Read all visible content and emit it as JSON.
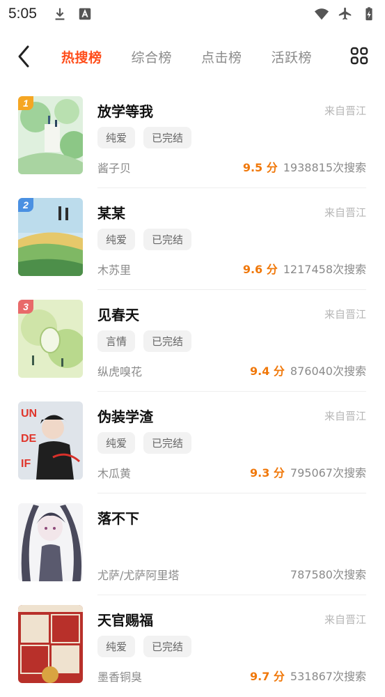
{
  "status": {
    "time": "5:05",
    "left_icons": [
      "download-icon",
      "font-a-icon"
    ],
    "right_icons": [
      "wifi-icon",
      "airplane-icon",
      "battery-charging-icon"
    ]
  },
  "nav": {
    "tabs": [
      {
        "label": "热搜榜",
        "active": true
      },
      {
        "label": "综合榜",
        "active": false
      },
      {
        "label": "点击榜",
        "active": false
      },
      {
        "label": "活跃榜",
        "active": false
      }
    ],
    "accent": "#ff4d1a"
  },
  "books": [
    {
      "rank": "1",
      "title": "放学等我",
      "source": "来自晋江",
      "tags": [
        "纯爱",
        "已完结"
      ],
      "author": "酱子贝",
      "score": "9.5 分",
      "count": "1938815次搜索"
    },
    {
      "rank": "2",
      "title": "某某",
      "source": "来自晋江",
      "tags": [
        "纯爱",
        "已完结"
      ],
      "author": "木苏里",
      "score": "9.6 分",
      "count": "1217458次搜索"
    },
    {
      "rank": "3",
      "title": "见春天",
      "source": "来自晋江",
      "tags": [
        "言情",
        "已完结"
      ],
      "author": "纵虎嗅花",
      "score": "9.4 分",
      "count": "876040次搜索"
    },
    {
      "rank": "",
      "title": "伪装学渣",
      "source": "来自晋江",
      "tags": [
        "纯爱",
        "已完结"
      ],
      "author": "木瓜黄",
      "score": "9.3 分",
      "count": "795067次搜索"
    },
    {
      "rank": "",
      "title": "落不下",
      "source": "",
      "tags": [],
      "author": "尤萨/尤萨阿里塔",
      "score": "",
      "count": "787580次搜索"
    },
    {
      "rank": "",
      "title": "天官赐福",
      "source": "来自晋江",
      "tags": [
        "纯爱",
        "已完结"
      ],
      "author": "墨香铜臭",
      "score": "9.7 分",
      "count": "531867次搜索"
    }
  ],
  "colors": {
    "score": "#f0780a",
    "rank1": "#f5a623",
    "rank2": "#4a90e2",
    "rank3": "#e86a6a"
  }
}
